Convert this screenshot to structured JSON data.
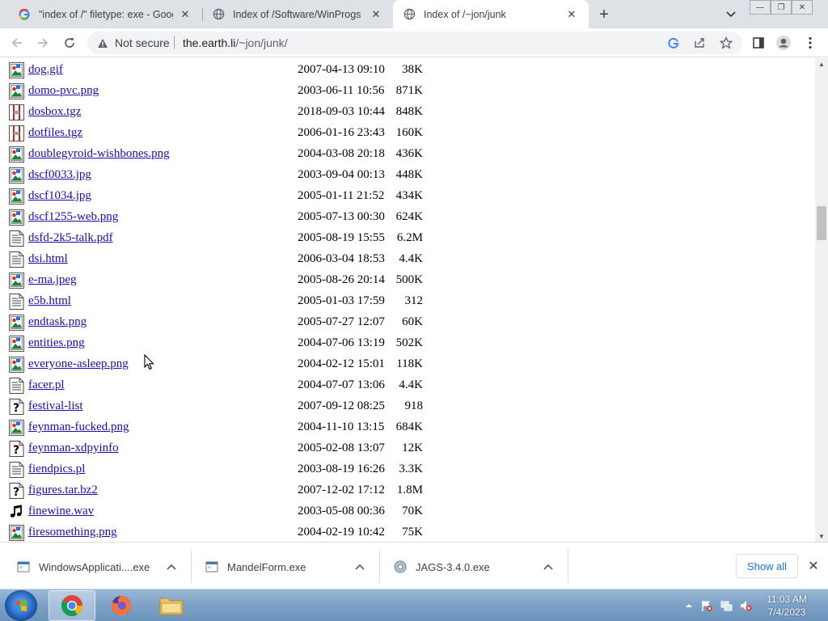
{
  "browser": {
    "tabs": [
      {
        "title": "\"index of /\" filetype: exe - Google",
        "active": false
      },
      {
        "title": "Index of /Software/WinProgs",
        "active": false
      },
      {
        "title": "Index of /~jon/junk",
        "active": true
      }
    ],
    "security_label": "Not secure",
    "url_host": "the.earth.li",
    "url_path": "/~jon/junk/"
  },
  "listing": [
    {
      "name": "dog.gif",
      "date": "2007-04-13 09:10",
      "size": "38K",
      "icon": "image-icon"
    },
    {
      "name": "domo-pvc.png",
      "date": "2003-06-11 10:56",
      "size": "871K",
      "icon": "image-icon"
    },
    {
      "name": "dosbox.tgz",
      "date": "2018-09-03 10:44",
      "size": "848K",
      "icon": "compressed-icon"
    },
    {
      "name": "dotfiles.tgz",
      "date": "2006-01-16 23:43",
      "size": "160K",
      "icon": "compressed-icon"
    },
    {
      "name": "doublegyroid-wishbones.png",
      "date": "2004-03-08 20:18",
      "size": "436K",
      "icon": "image-icon"
    },
    {
      "name": "dscf0033.jpg",
      "date": "2003-09-04 00:13",
      "size": "448K",
      "icon": "image-icon"
    },
    {
      "name": "dscf1034.jpg",
      "date": "2005-01-11 21:52",
      "size": "434K",
      "icon": "image-icon"
    },
    {
      "name": "dscf1255-web.png",
      "date": "2005-07-13 00:30",
      "size": "624K",
      "icon": "image-icon"
    },
    {
      "name": "dsfd-2k5-talk.pdf",
      "date": "2005-08-19 15:55",
      "size": "6.2M",
      "icon": "text-icon"
    },
    {
      "name": "dsi.html",
      "date": "2006-03-04 18:53",
      "size": "4.4K",
      "icon": "text-icon"
    },
    {
      "name": "e-ma.jpeg",
      "date": "2005-08-26 20:14",
      "size": "500K",
      "icon": "image-icon"
    },
    {
      "name": "e5b.html",
      "date": "2005-01-03 17:59",
      "size": "312",
      "icon": "text-icon"
    },
    {
      "name": "endtask.png",
      "date": "2005-07-27 12:07",
      "size": "60K",
      "icon": "image-icon"
    },
    {
      "name": "entities.png",
      "date": "2004-07-06 13:19",
      "size": "502K",
      "icon": "image-icon"
    },
    {
      "name": "everyone-asleep.png",
      "date": "2004-02-12 15:01",
      "size": "118K",
      "icon": "image-icon"
    },
    {
      "name": "facer.pl",
      "date": "2004-07-07 13:06",
      "size": "4.4K",
      "icon": "text-icon"
    },
    {
      "name": "festival-list",
      "date": "2007-09-12 08:25",
      "size": "918",
      "icon": "unknown-icon"
    },
    {
      "name": "feynman-fucked.png",
      "date": "2004-11-10 13:15",
      "size": "684K",
      "icon": "image-icon"
    },
    {
      "name": "feynman-xdpyinfo",
      "date": "2005-02-08 13:07",
      "size": "12K",
      "icon": "unknown-icon"
    },
    {
      "name": "fiendpics.pl",
      "date": "2003-08-19 16:26",
      "size": "3.3K",
      "icon": "text-icon"
    },
    {
      "name": "figures.tar.bz2",
      "date": "2007-12-02 17:12",
      "size": "1.8M",
      "icon": "unknown-icon"
    },
    {
      "name": "finewine.wav",
      "date": "2003-05-08 00:36",
      "size": "70K",
      "icon": "sound-icon"
    },
    {
      "name": "firesomething.png",
      "date": "2004-02-19 10:42",
      "size": "75K",
      "icon": "image-icon"
    }
  ],
  "downloads": {
    "items": [
      {
        "name": "WindowsApplicati....exe"
      },
      {
        "name": "MandelForm.exe"
      },
      {
        "name": "JAGS-3.4.0.exe"
      }
    ],
    "show_all": "Show all"
  },
  "taskbar": {
    "time": "11:03 AM",
    "date": "7/4/2023"
  }
}
